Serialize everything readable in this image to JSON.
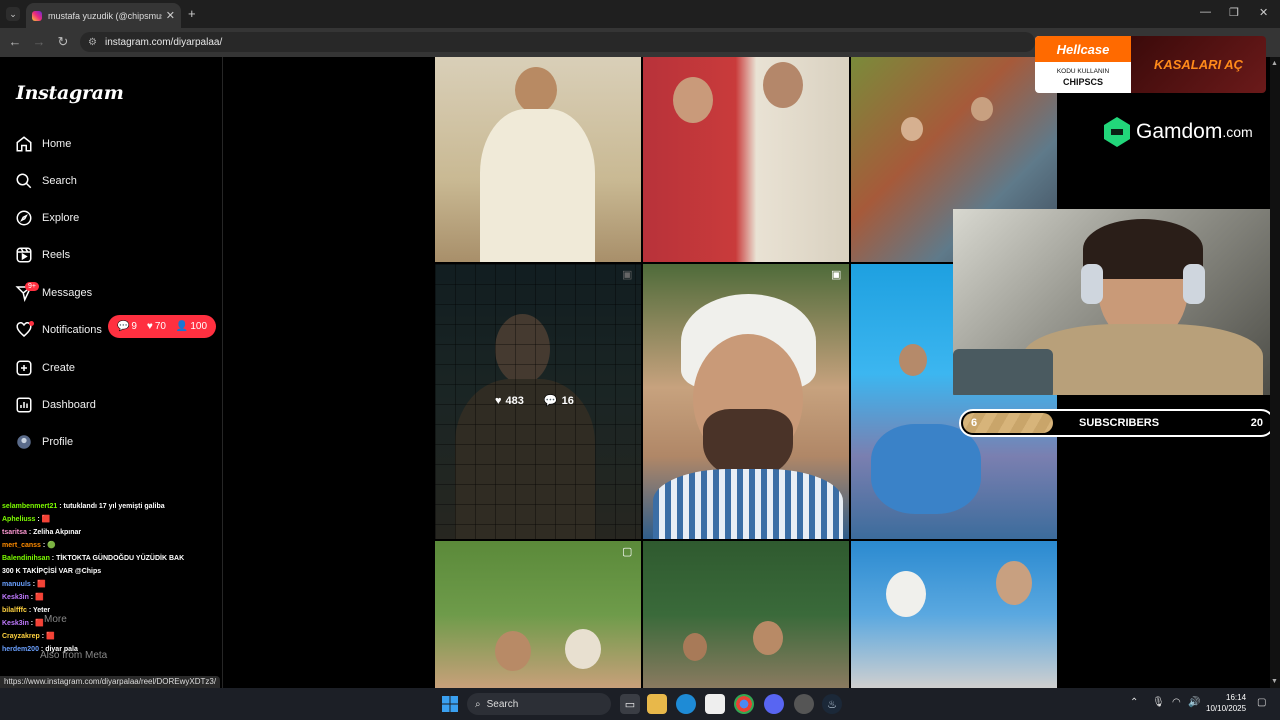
{
  "browser": {
    "tab_title": "mustafa yuzudik (@chipsmustafa",
    "url": "instagram.com/diyarpalaa/",
    "status_url": "https://www.instagram.com/diyarpalaa/reel/DOREwyXDTz3/"
  },
  "sidebar": {
    "logo": "Instagram",
    "items": [
      {
        "label": "Home",
        "icon": "home-icon"
      },
      {
        "label": "Search",
        "icon": "search-icon"
      },
      {
        "label": "Explore",
        "icon": "compass-icon"
      },
      {
        "label": "Reels",
        "icon": "reels-icon"
      },
      {
        "label": "Messages",
        "icon": "messenger-icon"
      },
      {
        "label": "Notifications",
        "icon": "heart-icon"
      },
      {
        "label": "Create",
        "icon": "plus-square-icon"
      },
      {
        "label": "Dashboard",
        "icon": "dashboard-icon"
      },
      {
        "label": "Profile",
        "icon": "avatar-icon"
      }
    ],
    "messages_badge": "9+",
    "notif_pill": {
      "comments": "9",
      "likes": "70",
      "follows": "100"
    },
    "more_label": "More",
    "meta_label": "Also from Meta"
  },
  "chat": [
    {
      "user": "selambenmert21",
      "msg": ": tutuklandı 17 yıl yemişti galiba",
      "color": "#7CFC00"
    },
    {
      "user": "Apheliuss",
      "msg": ": 🟥",
      "color": "#7CFC00"
    },
    {
      "user": "tsaritsa",
      "msg": ": Zeliha Akpınar",
      "color": "#ff9ad5"
    },
    {
      "user": "mert_canss",
      "msg": ": 🟢",
      "color": "#ff8c00"
    },
    {
      "user": "Balendinihsan",
      "msg": ": TİKTOKTA GÜNDOĞDU YÜZÜDİK BAK",
      "color": "#7CFC00"
    },
    {
      "user": "",
      "msg": "300 K TAKİPÇİSİ VAR @Chips",
      "color": "#ffffff"
    },
    {
      "user": "manuuls",
      "msg": ": 🟥",
      "color": "#6aa0ff"
    },
    {
      "user": "Kesk3in",
      "msg": ": 🟥",
      "color": "#c07aff"
    },
    {
      "user": "bilalfffc",
      "msg": ": Yeter",
      "color": "#ffd23f"
    },
    {
      "user": "Kesk3in",
      "msg": ": 🟥",
      "color": "#c07aff"
    },
    {
      "user": "Crayzakrep",
      "msg": ": 🟥",
      "color": "#ffd23f"
    },
    {
      "user": "herdem200",
      "msg": ": diyar pala",
      "color": "#6aa0ff"
    }
  ],
  "post_hover": {
    "likes": "483",
    "comments": "16"
  },
  "overlays": {
    "hellcase_brand": "Hellcase",
    "hellcase_sub": "KODU KULLANIN",
    "hellcase_code": "CHIPSCS",
    "hellcase_cta": "KASALARI AÇ",
    "gamdom_brand": "Gamdom",
    "gamdom_tld": ".com",
    "subs_current": "6",
    "subs_label": "SUBSCRIBERS",
    "subs_goal": "20"
  },
  "taskbar": {
    "search_placeholder": "Search",
    "time": "16:14",
    "date": "10/10/2025"
  },
  "colors": {
    "accent_red": "#ff3040",
    "hellcase_orange": "#ff6a00",
    "gamdom_green": "#22d67a"
  }
}
